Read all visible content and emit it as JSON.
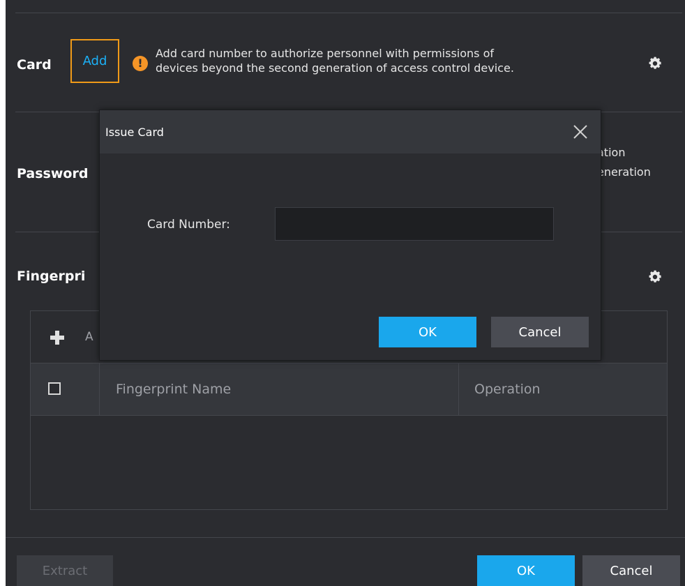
{
  "card": {
    "label": "Card",
    "add_label": "Add",
    "hint_line1": "Add card number to authorize personnel with permissions of",
    "hint_line2": "devices beyond the second generation of access control device."
  },
  "password": {
    "label": "Password",
    "partial_line1": "ation",
    "partial_line2": "eneration"
  },
  "fingerprint": {
    "label": "Fingerpri",
    "add_partial": "A",
    "columns": [
      "Fingerprint Name",
      "Operation"
    ]
  },
  "footer": {
    "extract_label": "Extract",
    "ok_label": "OK",
    "cancel_label": "Cancel"
  },
  "dialog": {
    "title": "Issue Card",
    "card_number_label": "Card Number:",
    "card_number_value": "",
    "ok_label": "OK",
    "cancel_label": "Cancel"
  },
  "colors": {
    "accent": "#1aa7ec",
    "link": "#1cb0f6",
    "focus_border": "#f09a18",
    "warning": "#f59527",
    "background": "#2b2c30"
  }
}
